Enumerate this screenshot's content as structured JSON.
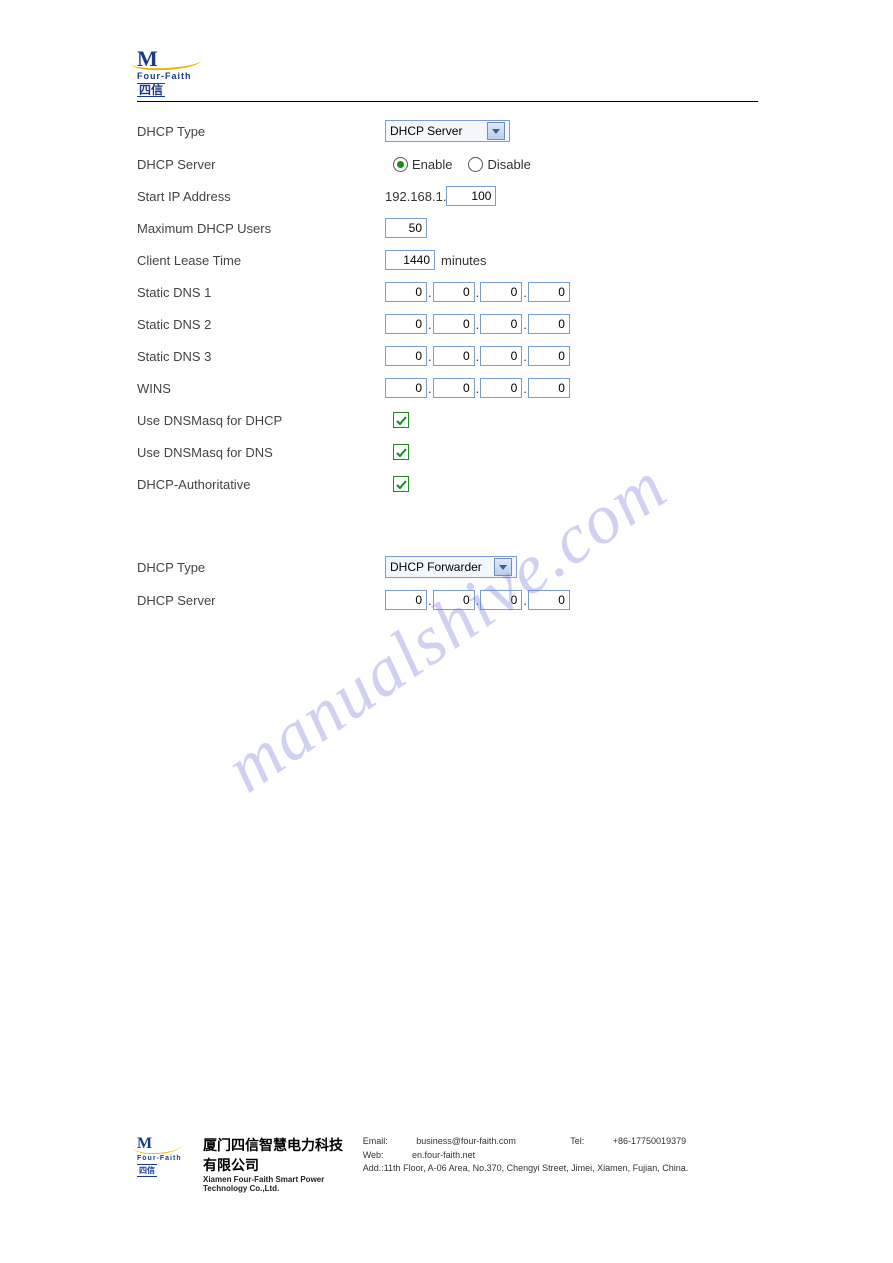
{
  "header": {
    "brand_initials": "M",
    "brand_name": "Four-Faith",
    "brand_cn": "四信"
  },
  "section1": {
    "labels": {
      "dhcp_type": "DHCP Type",
      "dhcp_server": "DHCP Server",
      "start_ip": "Start IP Address",
      "max_users": "Maximum DHCP Users",
      "lease_time": "Client Lease Time",
      "dns1": "Static DNS 1",
      "dns2": "Static DNS 2",
      "dns3": "Static DNS 3",
      "wins": "WINS",
      "dnsmasq_dhcp": "Use DNSMasq for DHCP",
      "dnsmasq_dns": "Use DNSMasq for DNS",
      "dhcp_auth": "DHCP-Authoritative"
    },
    "values": {
      "dhcp_type": "DHCP Server",
      "enable": "Enable",
      "disable": "Disable",
      "ip_prefix": "192.168.1.",
      "ip_last": "100",
      "max_users": "50",
      "lease_time": "1440",
      "minutes": "minutes",
      "oct": "0"
    }
  },
  "section2": {
    "labels": {
      "dhcp_type": "DHCP Type",
      "dhcp_server": "DHCP Server"
    },
    "values": {
      "dhcp_type": "DHCP Forwarder",
      "oct": "0"
    }
  },
  "watermark": "manualshive.com",
  "footer": {
    "company_cn": "厦门四信智慧电力科技有限公司",
    "company_en": "Xiamen Four-Faith Smart Power Technology Co.,Ltd.",
    "email_label": "Email: ",
    "email": "business@four-faith.com",
    "tel_label": "Tel: ",
    "tel": "+86-17750019379",
    "web_label": "Web: ",
    "web": "en.four-faith.net",
    "addr_label": "Add.:",
    "addr": "11th Floor, A-06 Area, No.370, Chengyi Street, Jimei, Xiamen, Fujian, China."
  }
}
